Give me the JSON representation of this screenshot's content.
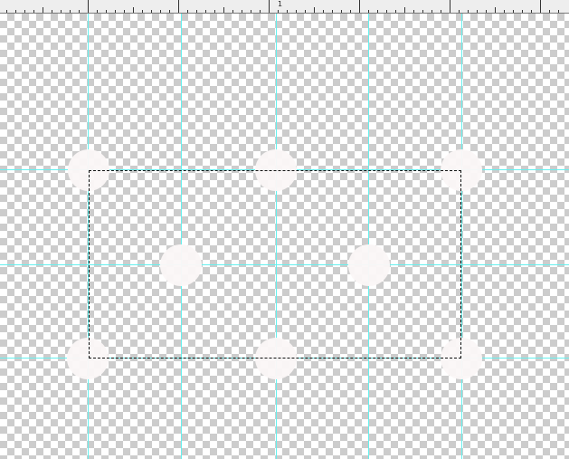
{
  "ruler": {
    "label": "1"
  },
  "colors": {
    "guide": "#66f0ee",
    "checker_dark": "#cccccc",
    "checker_light": "#ffffff",
    "blob": "#fbf7f7",
    "selection_border": "#111111"
  },
  "canvas": {
    "guides_vertical_count": 5,
    "guides_horizontal_count": 3,
    "blob_count": 8
  }
}
